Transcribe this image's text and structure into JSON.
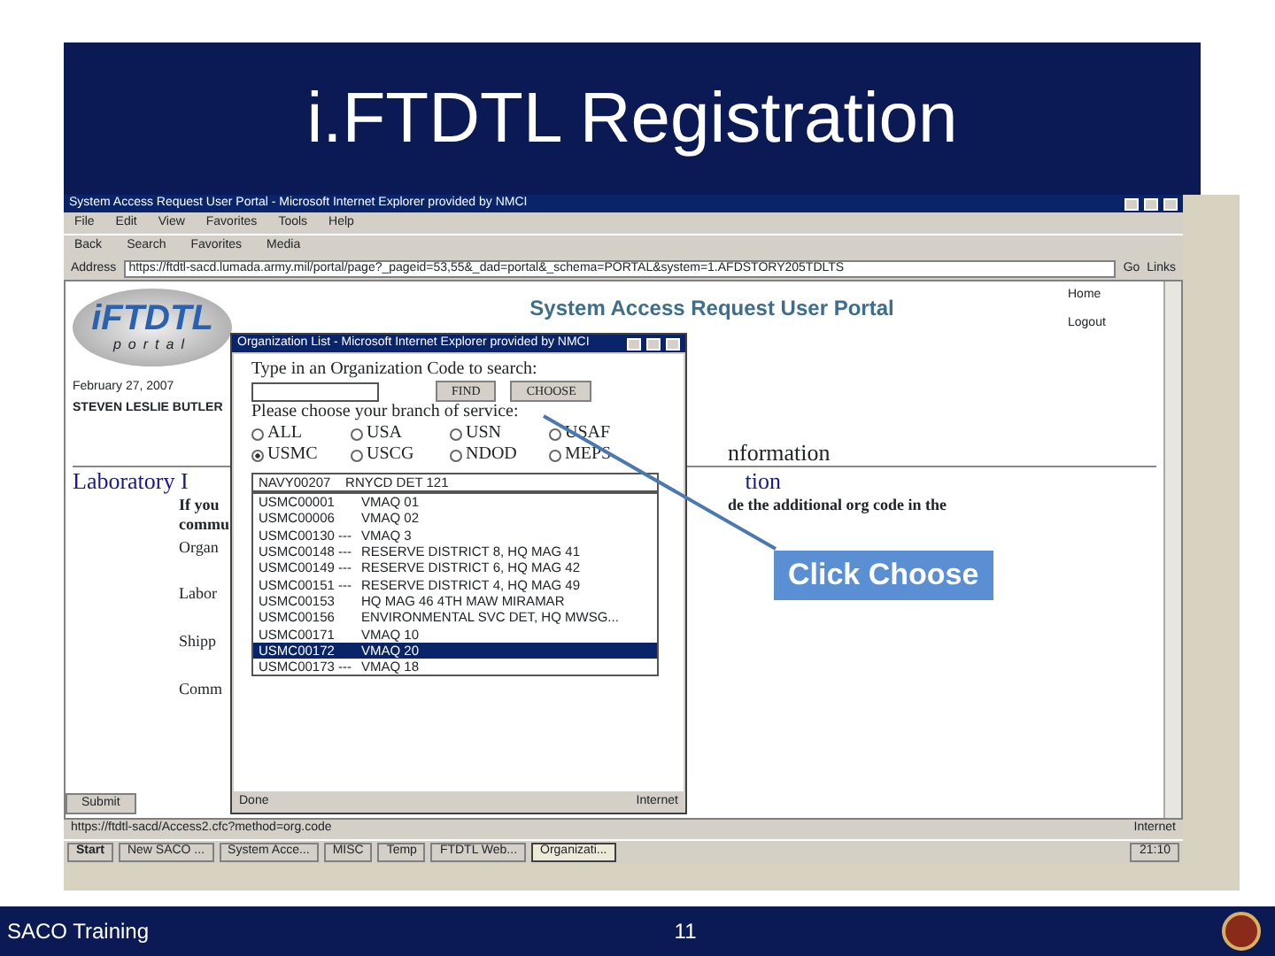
{
  "slide": {
    "title": "i.FTDTL Registration",
    "footer_left": "SACO Training",
    "page_number": "11"
  },
  "browser": {
    "title": "System Access Request User Portal - Microsoft Internet Explorer provided by NMCI",
    "menu": [
      "File",
      "Edit",
      "View",
      "Favorites",
      "Tools",
      "Help"
    ],
    "toolbar": [
      "Back",
      "Search",
      "Favorites",
      "Media"
    ],
    "address_label": "Address",
    "address": "https://ftdtl-sacd.lumada.army.mil/portal/page?_pageid=53,55&_dad=portal&_schema=PORTAL&system=1.AFDSTORY205TDLTS",
    "go": "Go",
    "links": "Links",
    "status": "https://ftdtl-sacd/Access2.cfc?method=org.code",
    "status_zone": "Internet"
  },
  "portal": {
    "logo_main": "iFTDTL",
    "logo_sub": "portal",
    "date": "February 27, 2007",
    "user": "STEVEN LESLIE BUTLER",
    "heading": "System Access Request User Portal",
    "nav": [
      "Home",
      "Logout"
    ],
    "section_title_right": "nformation",
    "subsection_left": "Laboratory I",
    "subsection_right": "tion",
    "note_left": "If you",
    "note_left_2": "commu",
    "note_right": "de the additional org code in the",
    "labels": [
      "Organ",
      "Labor",
      "Shipp",
      "Comm"
    ],
    "submit": "Submit"
  },
  "popup": {
    "title": "Organization List - Microsoft Internet Explorer provided by NMCI",
    "search_prompt": "Type in an Organization Code to search:",
    "find": "FIND",
    "choose": "CHOOSE",
    "branch_prompt": "Please choose your branch of service:",
    "branches": [
      {
        "label": "ALL",
        "selected": false
      },
      {
        "label": "USA",
        "selected": false
      },
      {
        "label": "USN",
        "selected": false
      },
      {
        "label": "USAF",
        "selected": false
      },
      {
        "label": "USMC",
        "selected": true
      },
      {
        "label": "USCG",
        "selected": false
      },
      {
        "label": "NDOD",
        "selected": false
      },
      {
        "label": "MEPS",
        "selected": false
      }
    ],
    "dropdown": "NAVY00207    RNYCD DET 121",
    "orgs": [
      {
        "code": "USMC00001",
        "name": "VMAQ 01",
        "selected": false
      },
      {
        "code": "USMC00006",
        "name": "VMAQ 02",
        "selected": false
      },
      {
        "code": "USMC00130 ---",
        "name": "VMAQ 3",
        "selected": false
      },
      {
        "code": "USMC00148 ---",
        "name": "RESERVE DISTRICT 8, HQ MAG 41",
        "selected": false
      },
      {
        "code": "USMC00149 ---",
        "name": "RESERVE DISTRICT 6, HQ MAG 42",
        "selected": false
      },
      {
        "code": "USMC00151 ---",
        "name": "RESERVE DISTRICT 4, HQ MAG 49",
        "selected": false
      },
      {
        "code": "USMC00153",
        "name": "HQ MAG 46 4TH MAW MIRAMAR",
        "selected": false
      },
      {
        "code": "USMC00156",
        "name": "ENVIRONMENTAL SVC DET, HQ MWSG...",
        "selected": false
      },
      {
        "code": "USMC00171",
        "name": "VMAQ 10",
        "selected": false
      },
      {
        "code": "USMC00172",
        "name": "VMAQ 20",
        "selected": true
      },
      {
        "code": "USMC00173 ---",
        "name": "VMAQ 18",
        "selected": false
      }
    ],
    "status": "Done",
    "status_zone": "Internet"
  },
  "taskbar": {
    "start": "Start",
    "tasks": [
      {
        "label": "New SACO ...",
        "selected": false
      },
      {
        "label": "System Acce...",
        "selected": false
      },
      {
        "label": "MISC",
        "selected": false
      },
      {
        "label": "Temp",
        "selected": false
      },
      {
        "label": "FTDTL Web...",
        "selected": false
      },
      {
        "label": "Organizati...",
        "selected": true
      }
    ],
    "clock": "21:10"
  },
  "callout": "Click Choose"
}
